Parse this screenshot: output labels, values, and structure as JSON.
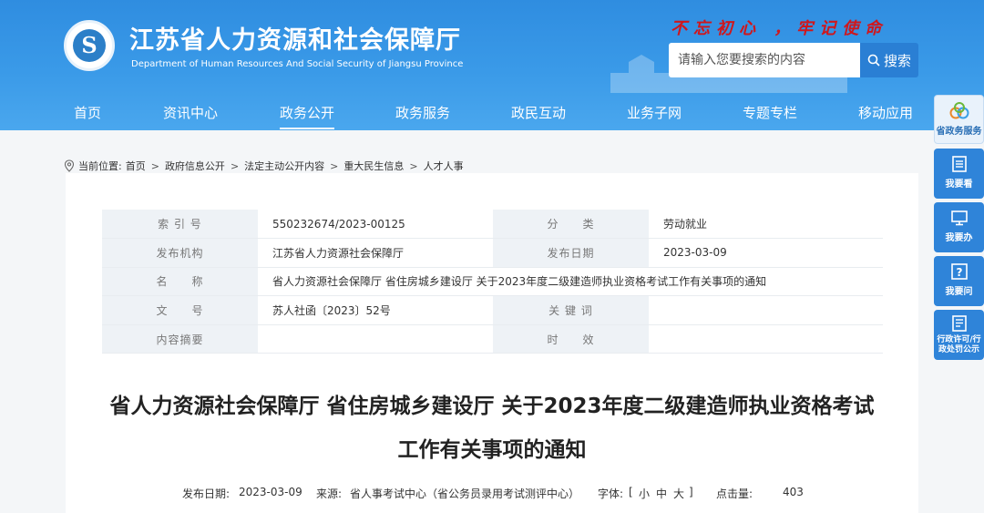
{
  "header": {
    "title": "江苏省人力资源和社会保障厅",
    "subtitle": "Department of Human Resources And Social Security of Jiangsu Province",
    "slogan": "不忘初心 ，牢记使命",
    "search_placeholder": "请输入您要搜索的内容",
    "search_label": "搜索",
    "colors": {
      "header": "#3a9ae8",
      "slogan": "#d0161b",
      "accent": "#2a7fd4"
    }
  },
  "nav": {
    "items": [
      {
        "label": "首页"
      },
      {
        "label": "资讯中心"
      },
      {
        "label": "政务公开"
      },
      {
        "label": "政务服务"
      },
      {
        "label": "政民互动"
      },
      {
        "label": "业务子网"
      },
      {
        "label": "专题专栏"
      },
      {
        "label": "移动应用"
      }
    ],
    "active_index": 2
  },
  "breadcrumb": {
    "prefix": "当前位置:",
    "items": [
      "首页",
      "政府信息公开",
      "法定主动公开内容",
      "重大民生信息",
      "人才人事"
    ]
  },
  "meta": {
    "index_label": "索 引 号",
    "index_value": "550232674/2023-00125",
    "category_label": "分　　类",
    "category_value": "劳动就业",
    "publisher_label": "发布机构",
    "publisher_value": "江苏省人力资源社会保障厅",
    "date_label": "发布日期",
    "date_value": "2023-03-09",
    "name_label": "名　　称",
    "name_value": "省人力资源社会保障厅 省住房城乡建设厅 关于2023年度二级建造师执业资格考试工作有关事项的通知",
    "docno_label": "文　　号",
    "docno_value": "苏人社函〔2023〕52号",
    "keyword_label": "关 键 词",
    "keyword_value": "",
    "abstract_label": "内容摘要",
    "abstract_value": "",
    "validity_label": "时　　效",
    "validity_value": ""
  },
  "article": {
    "title_line1": "省人力资源社会保障厅 省住房城乡建设厅 关于2023年度二级建造师执业资格考试",
    "title_line2": "工作有关事项的通知",
    "date_label": "发布日期:",
    "date_value": "2023-03-09",
    "source_label": "来源:",
    "source_value": "省人事考试中心（省公务员录用考试测评中心）",
    "font_label": "字体:",
    "font_open": "[",
    "font_small": "小",
    "font_medium": "中",
    "font_large": "大",
    "font_close": "]",
    "views_label": "点击量:",
    "views_value": "403"
  },
  "float_menu": [
    {
      "label": "省政务服务",
      "icon": "gov-service-logo-icon"
    },
    {
      "label": "我要看",
      "icon": "book-icon"
    },
    {
      "label": "我要办",
      "icon": "monitor-icon"
    },
    {
      "label": "我要问",
      "icon": "question-icon"
    },
    {
      "label": "行政许可/行政处罚公示",
      "icon": "document-icon"
    }
  ]
}
